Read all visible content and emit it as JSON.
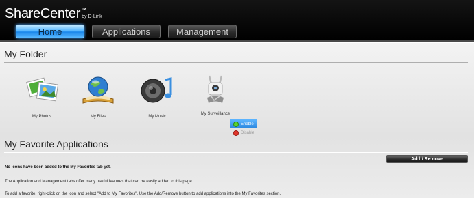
{
  "header": {
    "logo_main": "ShareCenter",
    "logo_tm": "™",
    "logo_by": "by D-Link",
    "tabs": [
      {
        "label": "Home",
        "active": true
      },
      {
        "label": "Applications",
        "active": false
      },
      {
        "label": "Management",
        "active": false
      }
    ]
  },
  "my_folder": {
    "title": "My Folder",
    "items": [
      {
        "label": "My Photos",
        "icon": "photos-icon"
      },
      {
        "label": "My Files",
        "icon": "globe-book-icon"
      },
      {
        "label": "My Music",
        "icon": "speaker-note-icon"
      },
      {
        "label": "My Surveillance",
        "icon": "camera-icon"
      }
    ]
  },
  "context_menu": {
    "enable_label": "Enable",
    "disable_label": "Disable",
    "enable_color": "#5bd12c",
    "disable_color": "#e0362b"
  },
  "favorites": {
    "title": "My Favorite Applications",
    "add_remove_label": "Add / Remove",
    "empty_message": "No icons have been added to the My Favorites tab yet.",
    "info_line1": "The Application and Management tabs offer many useful features that can be easily added to this page.",
    "info_line2": "To add a favorite, right-click on the icon and select \"Add to My Favorites\", Use the Add/Remove button to add applications into the My Favorites section."
  },
  "colors": {
    "header_bg": "#000000",
    "active_tab": "#3aa3ff",
    "body_bg": "#e9e9e9"
  }
}
